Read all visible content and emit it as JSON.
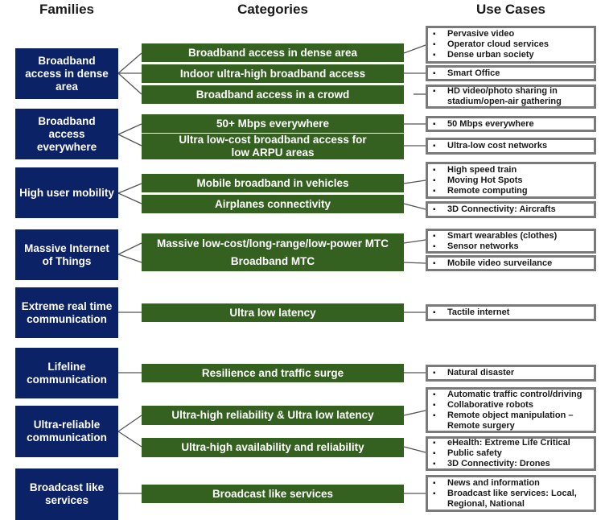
{
  "headers": {
    "families": "Families",
    "categories": "Categories",
    "use_cases": "Use Cases"
  },
  "colors": {
    "family_fill": "#0c2266",
    "category_fill": "#356120",
    "use_case_border": "#7a7a7a"
  },
  "families": [
    {
      "label": "Broadband access in dense area"
    },
    {
      "label": "Broadband access everywhere"
    },
    {
      "label": "High user mobility"
    },
    {
      "label": "Massive Internet of Things"
    },
    {
      "label": "Extreme real time communication"
    },
    {
      "label": "Lifeline communication"
    },
    {
      "label": "Ultra-reliable communication"
    },
    {
      "label": "Broadcast like services"
    }
  ],
  "categories": [
    {
      "label": "Broadband access in dense area"
    },
    {
      "label": "Indoor ultra-high  broadband access"
    },
    {
      "label": "Broadband access in a crowd"
    },
    {
      "label": "50+ Mbps everywhere"
    },
    {
      "label": "Ultra low-cost broadband access for low ARPU areas"
    },
    {
      "label": "Mobile broadband in vehicles"
    },
    {
      "label": "Airplanes connectivity"
    },
    {
      "label": "Massive low-cost/long-range/low-power MTC"
    },
    {
      "label": "Broadband MTC"
    },
    {
      "label": "Ultra low latency"
    },
    {
      "label": "Resilience and traffic surge"
    },
    {
      "label": "Ultra-high reliability  & Ultra low latency"
    },
    {
      "label": "Ultra-high availability  and reliability"
    },
    {
      "label": "Broadcast like services"
    }
  ],
  "use_cases": [
    {
      "items": [
        "Pervasive  video",
        "Operator cloud services",
        "Dense urban society"
      ]
    },
    {
      "items": [
        "Smart Office"
      ]
    },
    {
      "items": [
        "HD video/photo sharing in stadium/open-air gathering"
      ]
    },
    {
      "items": [
        "50 Mbps everywhere"
      ]
    },
    {
      "items": [
        "Ultra-low cost networks"
      ]
    },
    {
      "items": [
        "High speed train",
        "Moving Hot Spots",
        "Remote computing"
      ]
    },
    {
      "items": [
        "3D Connectivity:  Aircrafts"
      ]
    },
    {
      "items": [
        "Smart wearables  (clothes)",
        "Sensor networks"
      ]
    },
    {
      "items": [
        "Mobile video surveilance"
      ]
    },
    {
      "items": [
        "Tactile internet"
      ]
    },
    {
      "items": [
        "Natural disaster"
      ]
    },
    {
      "items": [
        "Automatic traffic control/driving",
        "Collaborative robots",
        "Remote object manipulation – Remote surgery"
      ]
    },
    {
      "items": [
        "eHealth: Extreme Life Critical",
        "Public safety",
        "3D Connectivity:  Drones"
      ]
    },
    {
      "items": [
        "News and information",
        "Broadcast  like services:  Local, Regional, National"
      ]
    }
  ]
}
